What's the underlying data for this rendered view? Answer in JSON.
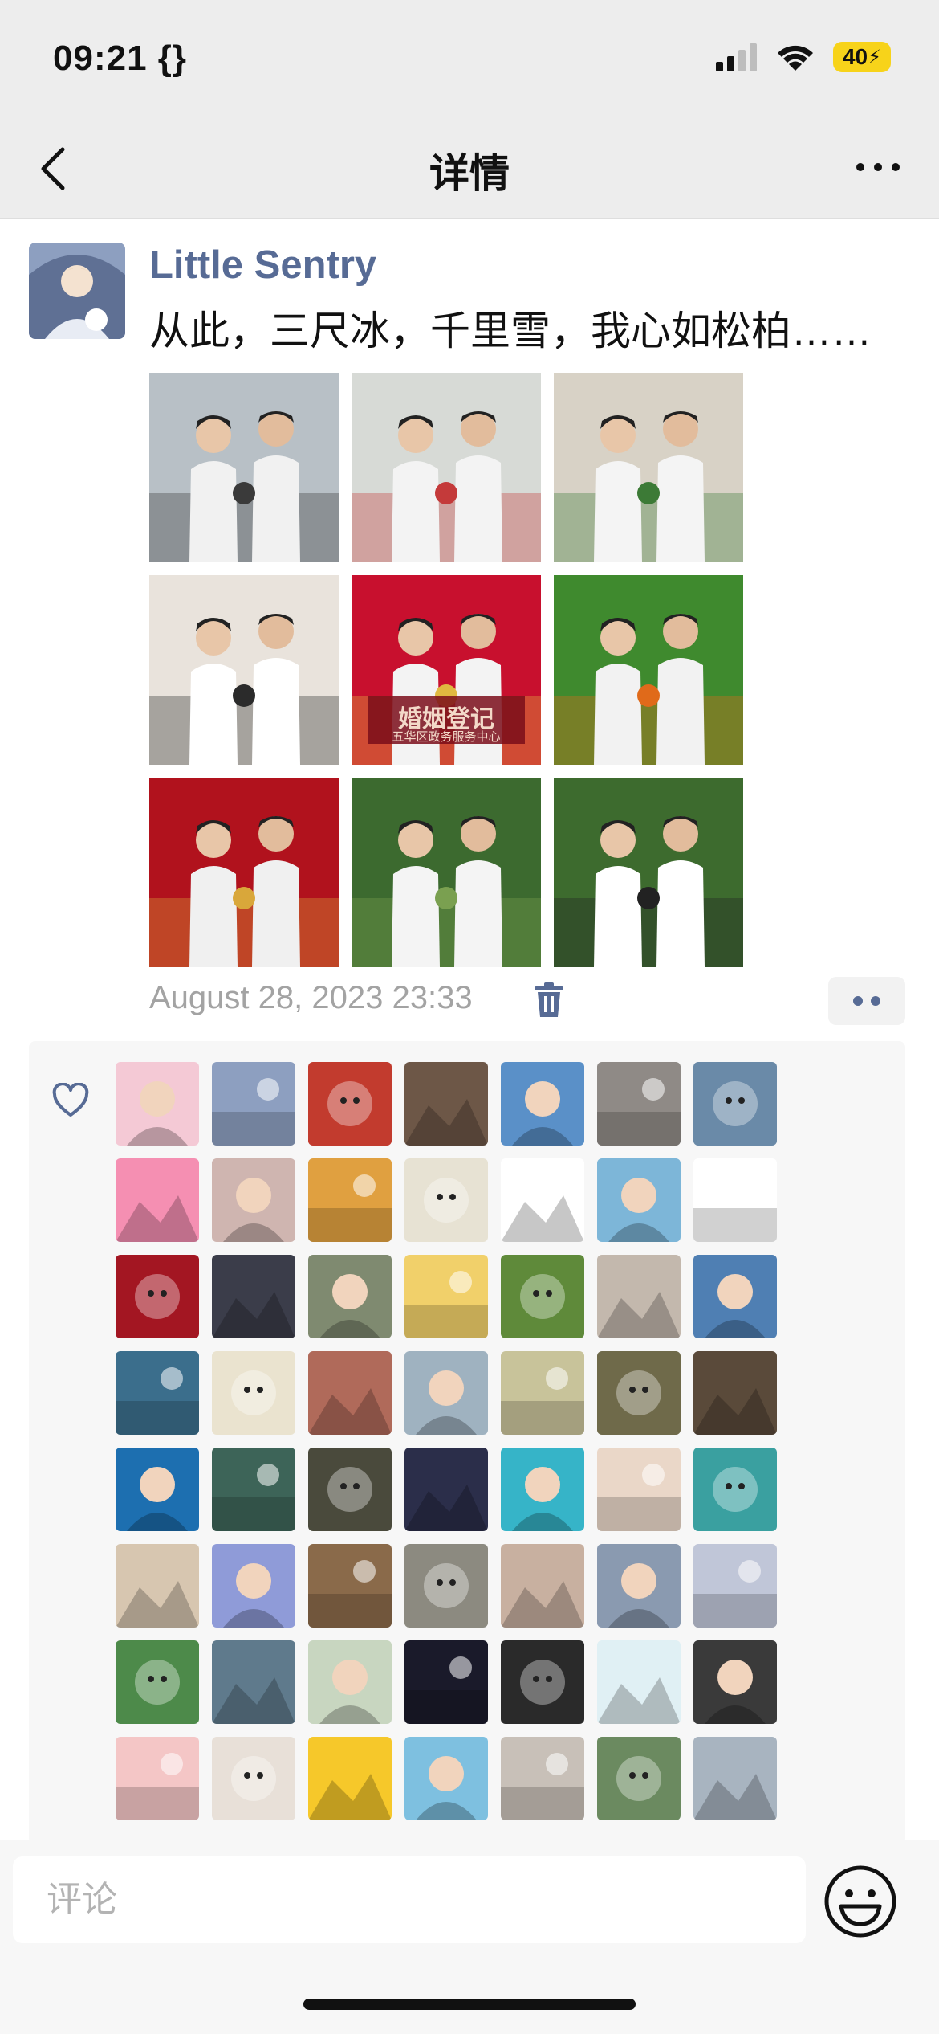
{
  "status_bar": {
    "time": "09:21 {}",
    "battery": "40"
  },
  "nav": {
    "title": "详情",
    "back_icon": "chevron-left-icon",
    "more_icon": "more-icon"
  },
  "post": {
    "username": "Little Sentry",
    "text": "从此，三尺冰，千里雪，我心如松柏……",
    "timestamp": "August 28, 2023 23:33",
    "photos": [
      {
        "caption": "",
        "colors": [
          "#b8c0c6",
          "#f1f1f1",
          "#3a3a3a"
        ]
      },
      {
        "caption": "",
        "colors": [
          "#d7dad6",
          "#f3f3f3",
          "#c43a3a"
        ]
      },
      {
        "caption": "",
        "colors": [
          "#d8d2c6",
          "#f4f4f4",
          "#3c7a36"
        ]
      },
      {
        "caption": "",
        "colors": [
          "#e9e3dc",
          "#ffffff",
          "#2b2b2b"
        ]
      },
      {
        "caption": "婚姻登记",
        "sub": "五华区政务服务中心",
        "colors": [
          "#c8102e",
          "#f3f3f3",
          "#e0b940"
        ]
      },
      {
        "caption": "",
        "colors": [
          "#3f8a2e",
          "#f2f2f2",
          "#e06a1a"
        ]
      },
      {
        "caption": "",
        "colors": [
          "#b1121d",
          "#f0f0f0",
          "#d9a73a"
        ]
      },
      {
        "caption": "",
        "colors": [
          "#3c6a2f",
          "#f4f4f4",
          "#7aa050"
        ]
      },
      {
        "caption": "",
        "colors": [
          "#3d6b2e",
          "#ffffff",
          "#222222"
        ]
      }
    ]
  },
  "likes": {
    "heart_icon": "heart-icon",
    "avatars": [
      "#f4c9d5",
      "#8d9fc0",
      "#c23b2e",
      "#6d5747",
      "#5a90c8",
      "#8f8a86",
      "#6a8aa8",
      "#f58fb2",
      "#cfb5b0",
      "#e0a040",
      "#e7e2d3",
      "#ffffff",
      "#7db6d8",
      "#ffffff",
      "#a31622",
      "#3b3d4a",
      "#7f8a70",
      "#f1d06a",
      "#5f8a3a",
      "#c3b8ad",
      "#4f7fb3",
      "#3b6e8c",
      "#eae3cf",
      "#b06a5a",
      "#9fb2c0",
      "#c8c39a",
      "#6f6a4a",
      "#5a4a3a",
      "#1d6fb0",
      "#3d6458",
      "#4a4a3c",
      "#2b2e4a",
      "#36b4c8",
      "#ead7c8",
      "#3aa0a0",
      "#d7c6b0",
      "#8f9bd8",
      "#8a6a4a",
      "#8c8a80",
      "#c8b0a0",
      "#8a9ab0",
      "#c0c6d8",
      "#4d8a4a",
      "#5f7a8c",
      "#c8d6c0",
      "#1a1a2a",
      "#2a2a2a",
      "#e0f0f4",
      "#3a3a3a",
      "#f4c6c6",
      "#e8e0d8",
      "#f6c82a",
      "#7ec0e0",
      "#c8c0b8",
      "#6b8a60",
      "#a8b4c0"
    ]
  },
  "bottom": {
    "comment_placeholder": "评论",
    "emoji_icon": "emoji-icon"
  }
}
